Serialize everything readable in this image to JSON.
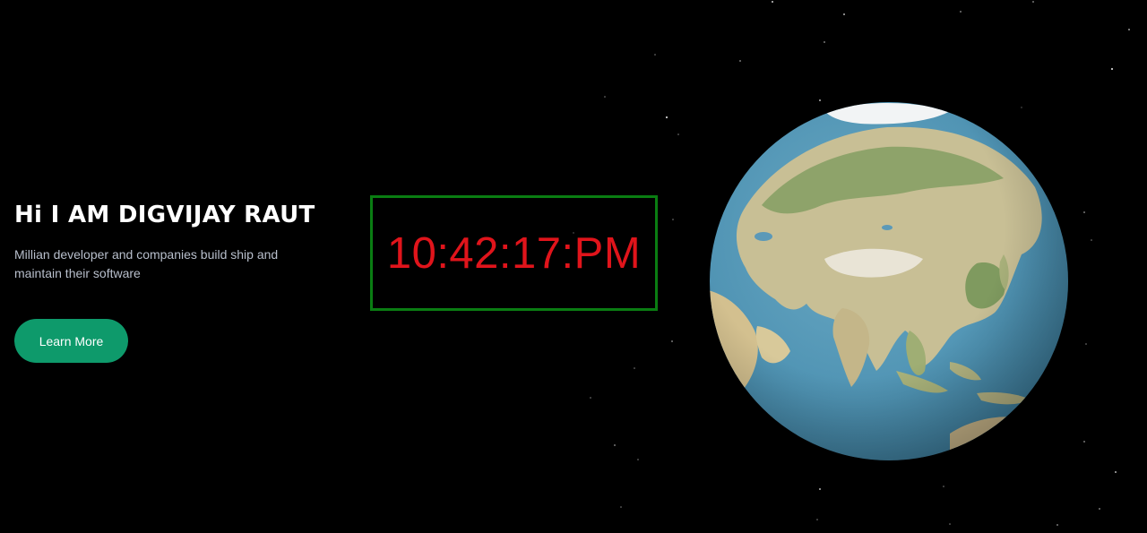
{
  "hero": {
    "title": "Hi I AM DIGVIJAY RAUT",
    "subtitle": "Millian developer and companies build ship and maintain their software",
    "button_label": "Learn More"
  },
  "clock": {
    "time": "10:42:17:PM"
  },
  "colors": {
    "background": "#000000",
    "button": "#0e9a6b",
    "clock_border": "#0a7d12",
    "clock_text": "#e0141b",
    "ocean": "#4f93b3"
  },
  "icons": {
    "globe": "earth-globe-icon"
  }
}
